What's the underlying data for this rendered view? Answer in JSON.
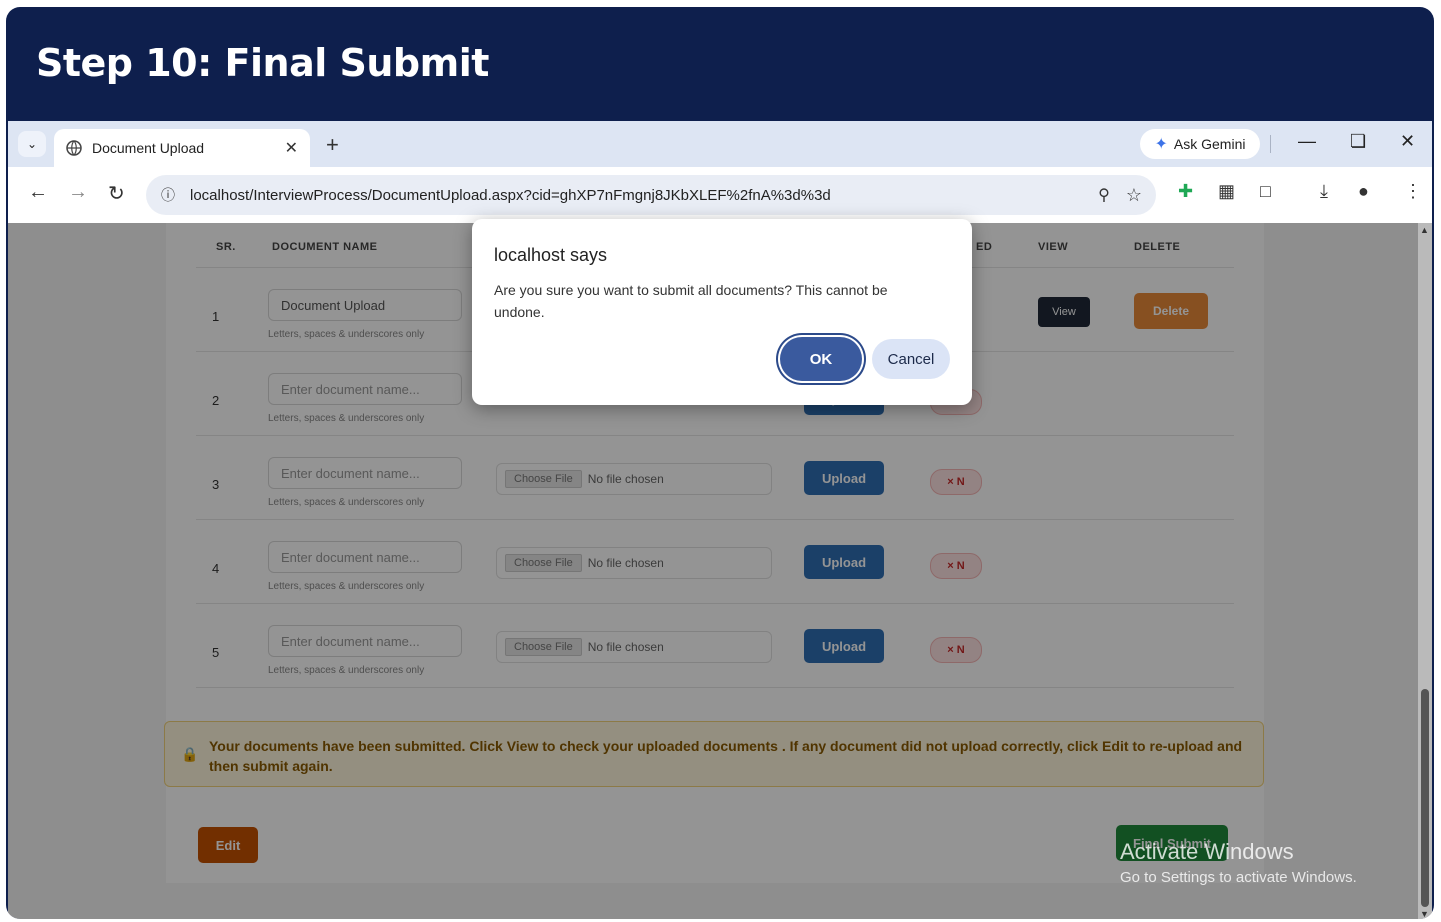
{
  "step_title": "Step 10: Final Submit",
  "browser": {
    "tab_title": "Document Upload",
    "gemini_label": "Ask Gemini",
    "url": "localhost/InterviewProcess/DocumentUpload.aspx?cid=ghXP7nFmgnj8JKbXLEF%2fnA%3d%3d"
  },
  "table": {
    "headers": {
      "sr": "SR.",
      "doc_name": "DOCUMENT NAME",
      "uploaded": "ED",
      "view": "VIEW",
      "delete": "DELETE"
    },
    "rows": [
      {
        "sr": "1",
        "name_value": "Document Upload",
        "hint": "Letters, spaces & underscores only"
      },
      {
        "sr": "2",
        "name_placeholder": "Enter document name...",
        "hint": "Letters, spaces & underscores only",
        "upload": "Upload",
        "status": "N"
      },
      {
        "sr": "3",
        "name_placeholder": "Enter document name...",
        "hint": "Letters, spaces & underscores only",
        "choose": "Choose File",
        "nofile": "No file chosen",
        "upload": "Upload",
        "status": "× N"
      },
      {
        "sr": "4",
        "name_placeholder": "Enter document name...",
        "hint": "Letters, spaces & underscores only",
        "choose": "Choose File",
        "nofile": "No file chosen",
        "upload": "Upload",
        "status": "× N"
      },
      {
        "sr": "5",
        "name_placeholder": "Enter document name...",
        "hint": "Letters, spaces & underscores only",
        "choose": "Choose File",
        "nofile": "No file chosen",
        "upload": "Upload",
        "status": "× N"
      }
    ],
    "view_label": "View",
    "delete_label": "Delete"
  },
  "notice_text": "Your documents have been submitted. Click View to check your uploaded documents . If any document did not upload correctly, click Edit to re-upload and then submit again.",
  "buttons": {
    "edit": "Edit",
    "final_submit": "Final Submit"
  },
  "watermark": {
    "line1": "Activate Windows",
    "line2": "Go to Settings to activate Windows."
  },
  "dialog": {
    "title": "localhost says",
    "message": "Are you sure you want to submit all documents? This cannot be undone.",
    "ok": "OK",
    "cancel": "Cancel"
  },
  "colors": {
    "header_bg": "#0e1f4d",
    "ok_button": "#3a5a9e",
    "final_submit": "#1f8a3b",
    "edit": "#c45100"
  }
}
